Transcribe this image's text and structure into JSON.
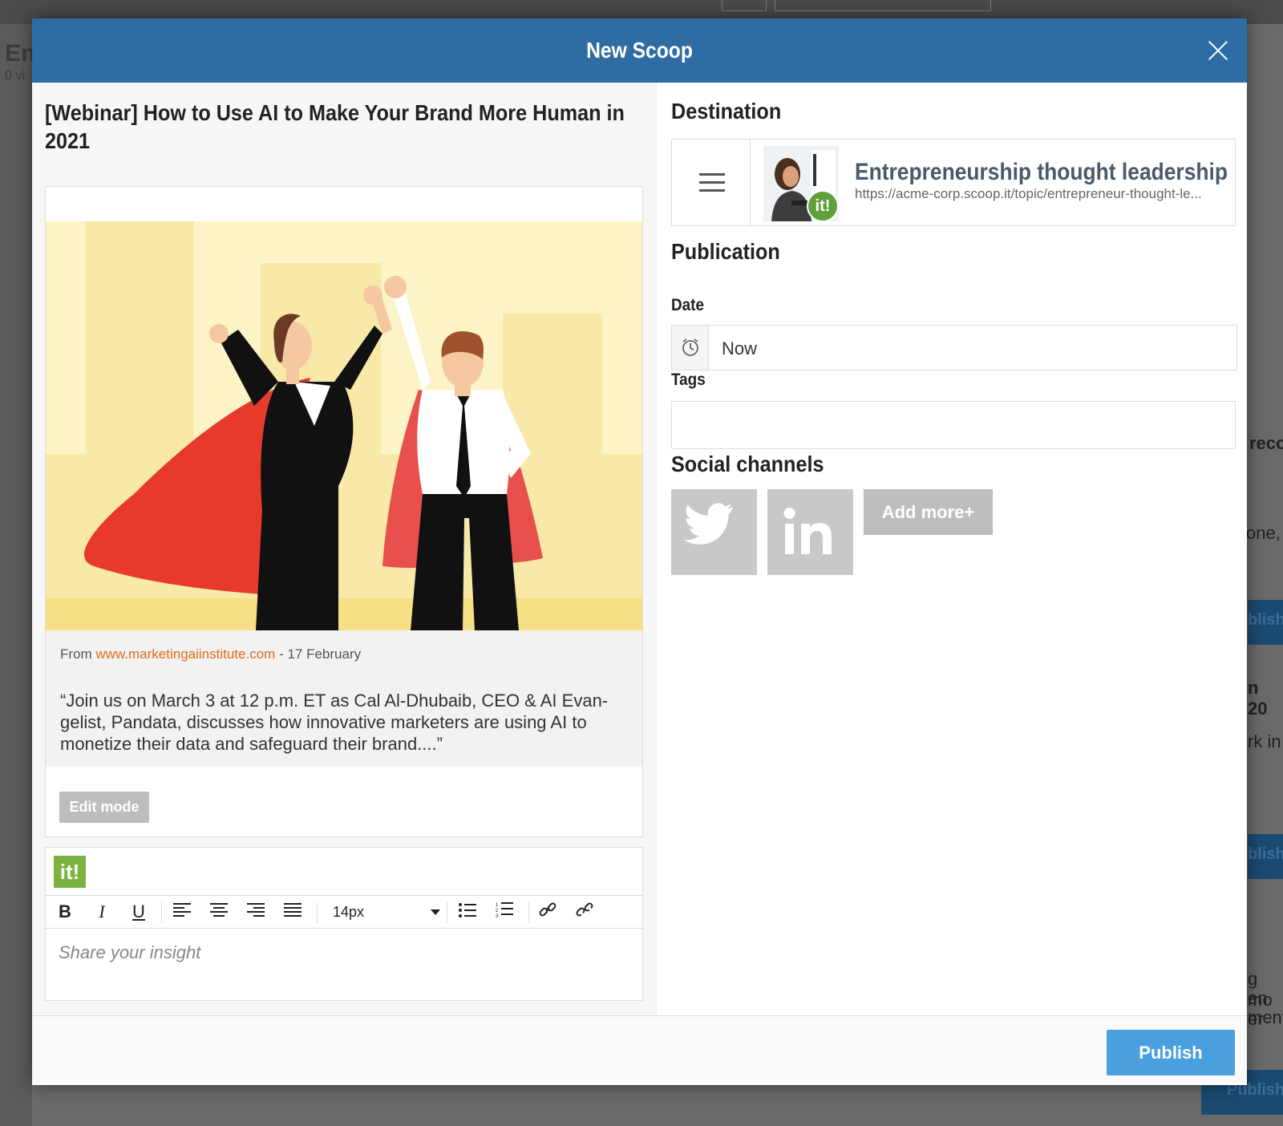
{
  "background": {
    "title_fragment": "En",
    "subtitle_fragment": "0 vi",
    "right_fragments": [
      "reco",
      "one,",
      "n 20",
      "rk in",
      "g mo",
      "en er",
      "ment"
    ],
    "publish_fragment_1": "blish",
    "publish_fragment_2": "blish",
    "bottom_publish": "Publish"
  },
  "modal": {
    "title": "New Scoop",
    "close_icon": "close-icon"
  },
  "scoop": {
    "title": "[Webinar] How to Use AI to Make Your Brand More Human in 2021",
    "from_label": "From",
    "source_url": "www.marketingaiinstitute.com",
    "date": "- 17 February",
    "quote": "“Join us on March 3 at 12 p.m. ET as Cal Al-Dhubaib, CEO & AI Evan-gelist, Pandata, discusses how innovative marketers are using AI to monetize their data and safeguard their brand....”",
    "edit_mode_label": "Edit mode"
  },
  "editor": {
    "brand": "it!",
    "font_size": "14px",
    "placeholder": "Share your insight",
    "tools": [
      "bold",
      "italic",
      "underline",
      "align-left",
      "align-center",
      "align-right",
      "align-justify",
      "bullet-list",
      "numbered-list",
      "link",
      "unlink"
    ]
  },
  "destination": {
    "section_title": "Destination",
    "topic_name": "Entrepreneurship thought leadership",
    "topic_url": "https://acme-corp.scoop.it/topic/entrepreneur-thought-le...",
    "badge": "it!"
  },
  "publication": {
    "section_title": "Publication",
    "date_label": "Date",
    "date_value": "Now",
    "tags_label": "Tags",
    "tags_value": ""
  },
  "social": {
    "section_title": "Social channels",
    "channels": [
      "twitter",
      "linkedin"
    ],
    "linkedin_text": "in",
    "add_more_label": "Add more+"
  },
  "footer": {
    "publish_label": "Publish"
  },
  "colors": {
    "header_blue": "#2e6da4",
    "publish_blue": "#4aa0de",
    "source_link": "#e06b1a",
    "brand_green": "#7bb341"
  }
}
